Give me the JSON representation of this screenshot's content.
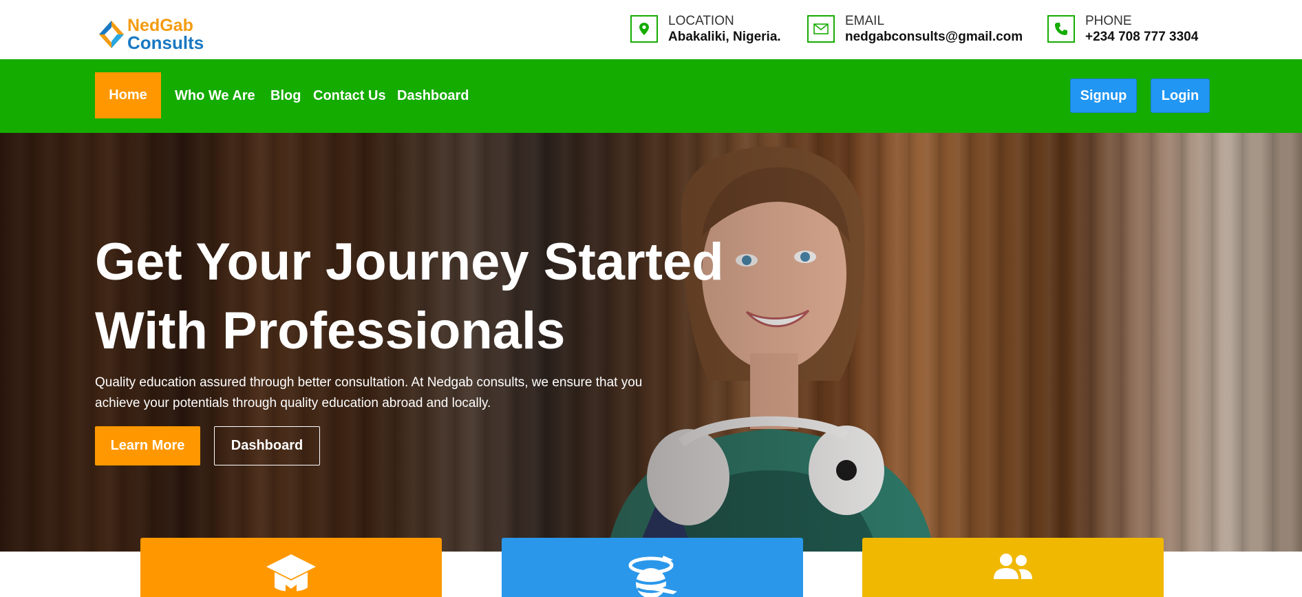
{
  "brand": {
    "line1": "NedGab",
    "line2": "Consults"
  },
  "contacts": {
    "location": {
      "label": "LOCATION",
      "value": "Abakaliki, Nigeria.",
      "icon": "map-pin-icon"
    },
    "email": {
      "label": "EMAIL",
      "value": "nedgabconsults@gmail.com",
      "icon": "envelope-icon"
    },
    "phone": {
      "label": "PHONE",
      "value": "+234 708 777 3304",
      "icon": "phone-icon"
    }
  },
  "nav": {
    "items": [
      "Home",
      "Who We Are",
      "Blog",
      "Contact Us",
      "Dashboard"
    ],
    "active": "Home",
    "signup": "Signup",
    "login": "Login"
  },
  "hero": {
    "title_line1": "Get Your Journey Started",
    "title_line2": "With Professionals",
    "text": "Quality education assured through better consultation. At Nedgab consults, we ensure that you achieve your potentials through quality education abroad and locally.",
    "learn_more": "Learn More",
    "dashboard": "Dashboard"
  },
  "cards": [
    {
      "icon": "graduation-cap-icon",
      "color": "#ff9800"
    },
    {
      "icon": "globe-plane-icon",
      "color": "#2b97ea"
    },
    {
      "icon": "users-icon",
      "color": "#f0b800"
    }
  ],
  "colors": {
    "green": "#15ac00",
    "orange": "#ff9800",
    "blue": "#2196f3"
  }
}
